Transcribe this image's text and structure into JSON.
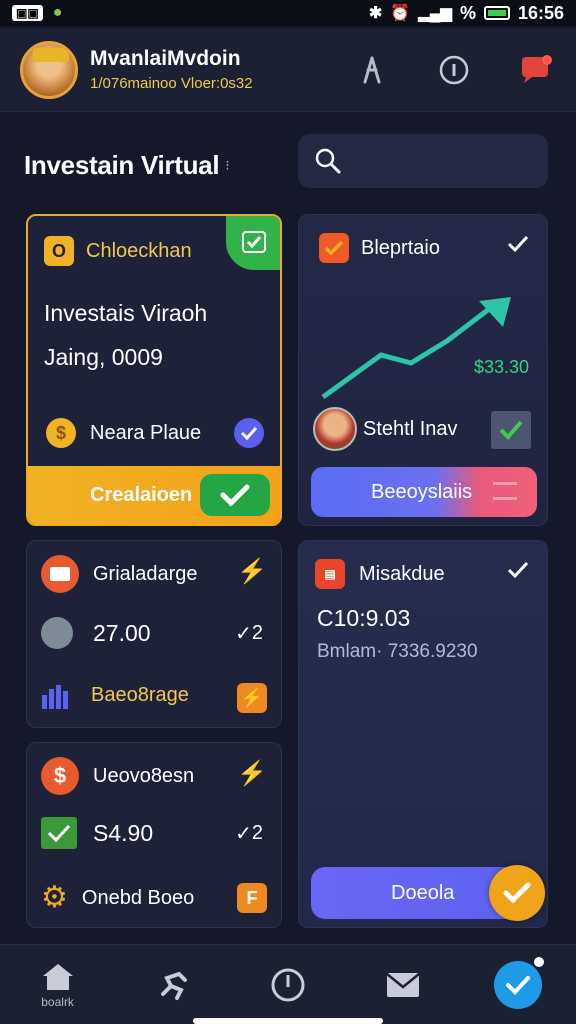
{
  "status_bar": {
    "time": "16:56",
    "battery": "%"
  },
  "header": {
    "name": "MvanlaiMvdoin",
    "subtitle": "1/076mainoo Vloer:0s32"
  },
  "page": {
    "title": "Investain Virtual"
  },
  "card_a": {
    "badge": "O",
    "title": "Chloeckhan",
    "headline": "Investais Viraoh",
    "value": "Jaing, 0009",
    "coin_label": "Neara Plaue",
    "cta_label": "Crealaioen"
  },
  "card_b": {
    "title": "Bleprtaio",
    "gain": "$33.30",
    "user_label": "Stehtl Inav",
    "cta_label": "Beeoyslaiis"
  },
  "card_c": {
    "title": "Grialadarge",
    "value": "27.00",
    "value_trail": "2",
    "bottom_label": "Baeo8rage"
  },
  "card_d": {
    "title": "Misakdue",
    "value": "C10:9.03",
    "subtext": "Bmlam· 7336.9230",
    "cta_label": "Doeola"
  },
  "card_e": {
    "title": "Ueovo8esn",
    "value": "S4.90",
    "value_trail": "2",
    "bottom_label": "Onebd Boeo"
  },
  "bottom_nav": {
    "home_label": "boalrk"
  },
  "colors": {
    "accent_yellow": "#f1a91e",
    "accent_green": "#24a644",
    "accent_purple": "#5b62f0",
    "background": "#15182a"
  }
}
